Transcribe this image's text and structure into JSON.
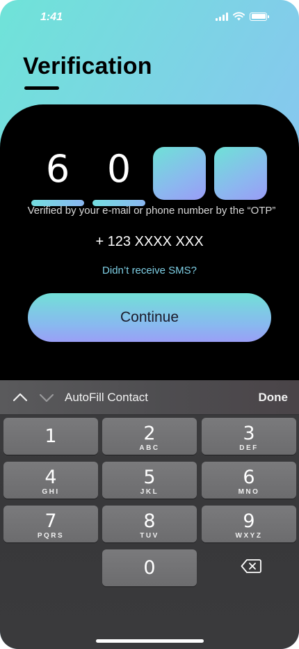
{
  "status_bar": {
    "time": "1:41",
    "icons": [
      "signal-icon",
      "wifi-icon",
      "battery-icon"
    ]
  },
  "header": {
    "title": "Verification"
  },
  "otp": {
    "digits": [
      "6",
      "0",
      "",
      ""
    ]
  },
  "verification": {
    "helper_text": "Verified by your e-mail or phone number by the “OTP”",
    "phone": "+ 123 XXXX XXX",
    "resend_link": "Didn’t receive SMS?"
  },
  "actions": {
    "continue_label": "Continue"
  },
  "keyboard": {
    "toolbar": {
      "autofill_label": "AutoFill Contact",
      "done_label": "Done"
    },
    "keys": [
      {
        "digit": "1",
        "letters": ""
      },
      {
        "digit": "2",
        "letters": "ABC"
      },
      {
        "digit": "3",
        "letters": "DEF"
      },
      {
        "digit": "4",
        "letters": "GHI"
      },
      {
        "digit": "5",
        "letters": "JKL"
      },
      {
        "digit": "6",
        "letters": "MNO"
      },
      {
        "digit": "7",
        "letters": "PQRS"
      },
      {
        "digit": "8",
        "letters": "TUV"
      },
      {
        "digit": "9",
        "letters": "WXYZ"
      },
      {
        "digit": "0",
        "letters": ""
      }
    ]
  },
  "colors": {
    "accent_teal": "#6fe3d8",
    "accent_violet": "#9a9cf6",
    "link": "#7fd0e6",
    "sheet_background": "#000000",
    "keyboard_key": "#747476"
  }
}
